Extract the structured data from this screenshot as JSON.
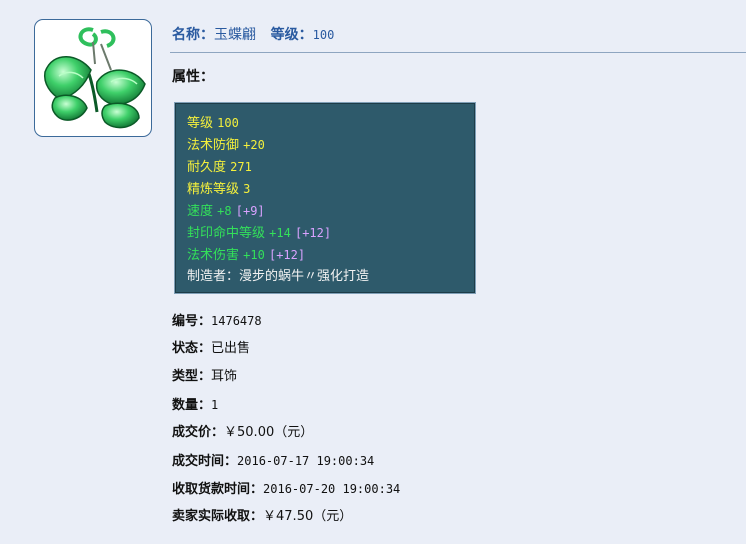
{
  "item": {
    "name_label": "名称：",
    "name_value": "玉蝶翩",
    "level_label": "等级：",
    "level_value": "100",
    "icon": "jade-butterfly-earring-icon",
    "attributes_title": "属性：",
    "attributes": [
      {
        "label": "等级",
        "value": "100",
        "bonus": "",
        "color": "#f4f03c"
      },
      {
        "label": "法术防御",
        "value": "+20",
        "bonus": "",
        "color": "#f4f03c"
      },
      {
        "label": "耐久度",
        "value": "271",
        "bonus": "",
        "color": "#f4f03c"
      },
      {
        "label": "精炼等级",
        "value": "3",
        "bonus": "",
        "color": "#f4f03c"
      },
      {
        "label": "速度",
        "value": "+8",
        "bonus": "[+9]",
        "color": "#33e05a"
      },
      {
        "label": "封印命中等级",
        "value": "+14",
        "bonus": "[+12]",
        "color": "#33e05a"
      },
      {
        "label": "法术伤害",
        "value": "+10",
        "bonus": "[+12]",
        "color": "#33e05a"
      }
    ],
    "maker": "制造者：漫步的蜗牛〃强化打造"
  },
  "details": [
    {
      "label": "编号：",
      "value": "1476478"
    },
    {
      "label": "状态：",
      "value": "已出售"
    },
    {
      "label": "类型：",
      "value": "耳饰"
    },
    {
      "label": "数量：",
      "value": "1"
    },
    {
      "label": "成交价：",
      "value": "￥50.00（元）"
    },
    {
      "label": "成交时间：",
      "value": "2016-07-17 19:00:34"
    },
    {
      "label": "收取货款时间：",
      "value": "2016-07-20 19:00:34"
    },
    {
      "label": "卖家实际收取：",
      "value": "￥47.50（元）"
    }
  ],
  "colors": {
    "accent": "#2a5aa0",
    "panel": "#2e5a6b",
    "background": "#eaeef7"
  }
}
